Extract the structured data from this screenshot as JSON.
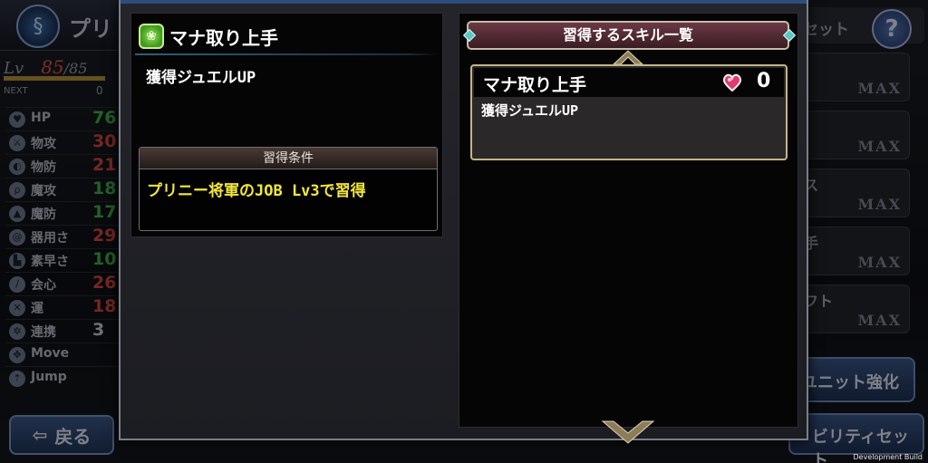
{
  "header": {
    "character_name": "プリ"
  },
  "level": {
    "label": "Lv",
    "current": "85",
    "max": "/85",
    "next_label": "NEXT",
    "next_value": "0"
  },
  "stats": [
    {
      "label": "HP",
      "value": "76",
      "color": "green"
    },
    {
      "label": "物攻",
      "value": "30",
      "color": "red"
    },
    {
      "label": "物防",
      "value": "21",
      "color": "red"
    },
    {
      "label": "魔攻",
      "value": "18",
      "color": "green"
    },
    {
      "label": "魔防",
      "value": "17",
      "color": "green"
    },
    {
      "label": "器用さ",
      "value": "29",
      "color": "red"
    },
    {
      "label": "素早さ",
      "value": "10",
      "color": "green"
    },
    {
      "label": "会心",
      "value": "26",
      "color": "red"
    },
    {
      "label": "運",
      "value": "18",
      "color": "red"
    },
    {
      "label": "連携",
      "value": "3",
      "color": "white"
    },
    {
      "label": "Move",
      "value": "",
      "color": "white"
    },
    {
      "label": "Jump",
      "value": "",
      "color": "white"
    }
  ],
  "back_button": {
    "label": "戻る"
  },
  "right_column": {
    "top_label": "セット",
    "help_label": "?",
    "cards": [
      {
        "title": "",
        "max": "MAX"
      },
      {
        "title": "",
        "max": "MAX"
      },
      {
        "title": "ス",
        "max": "MAX"
      },
      {
        "title": "手",
        "max": "MAX"
      },
      {
        "title": "フト",
        "max": "MAX"
      }
    ],
    "unit_button": "ユニット強化",
    "ability_button": "ビリティセット"
  },
  "detail": {
    "skill_name": "マナ取り上手",
    "skill_desc": "獲得ジュエルUP",
    "condition_header": "習得条件",
    "condition_text": "プリニー将軍のJOB Lv3で習得"
  },
  "skill_list": {
    "header": "習得するスキル一覧",
    "items": [
      {
        "name": "マナ取り上手",
        "count": "0",
        "desc": "獲得ジュエルUP"
      }
    ]
  },
  "footer": {
    "dev_build": "Development Build"
  },
  "colors": {
    "accent_gold": "#c5b48a",
    "condition_yellow": "#f3e73a",
    "header_maroon": "#6b3a44"
  }
}
